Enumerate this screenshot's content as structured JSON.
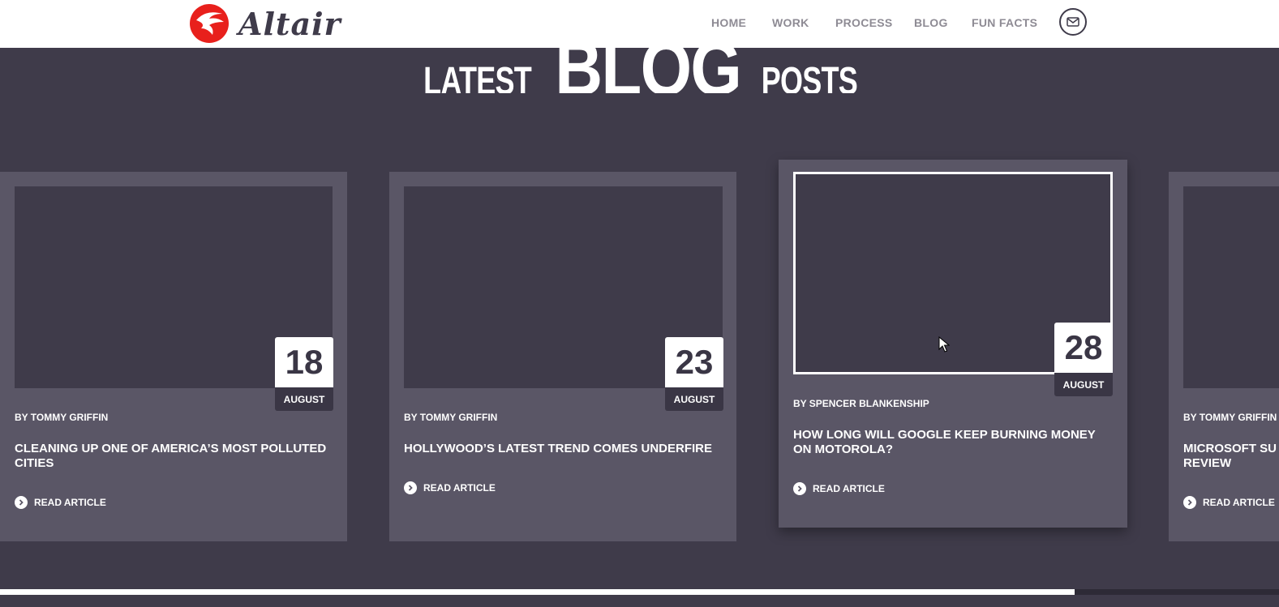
{
  "brand": {
    "name": "Altair"
  },
  "nav": {
    "items": [
      {
        "label": "HOME"
      },
      {
        "label": "WORK"
      },
      {
        "label": "PROCESS"
      },
      {
        "label": "BLOG"
      },
      {
        "label": "FUN FACTS"
      }
    ],
    "contact_icon": "envelope-icon"
  },
  "section": {
    "heading_left": "LATEST",
    "heading_big": "BLOG",
    "heading_right": "POSTS"
  },
  "posts": [
    {
      "day": "18",
      "month": "AUGUST",
      "author": "BY TOMMY GRIFFIN",
      "title": "CLEANING UP ONE OF AMERICA’S MOST POLLUTED CITIES",
      "cta": "READ ARTICLE"
    },
    {
      "day": "23",
      "month": "AUGUST",
      "author": "BY TOMMY GRIFFIN",
      "title": "HOLLYWOOD’S LATEST TREND COMES UNDERFIRE",
      "cta": "READ ARTICLE"
    },
    {
      "day": "28",
      "month": "AUGUST",
      "author": "BY SPENCER BLANKENSHIP",
      "title": "HOW LONG WILL GOOGLE KEEP BURNING MONEY ON MOTOROLA?",
      "cta": "READ ARTICLE"
    },
    {
      "author": "BY TOMMY GRIFFIN",
      "title": "MICROSOFT SU… REVIEW",
      "cta": "READ ARTICLE"
    }
  ],
  "carousel": {
    "progress_fraction": 0.84
  },
  "colors": {
    "background": "#3f3b4a",
    "card": "#5a5666",
    "accent_red": "#e8201c"
  }
}
